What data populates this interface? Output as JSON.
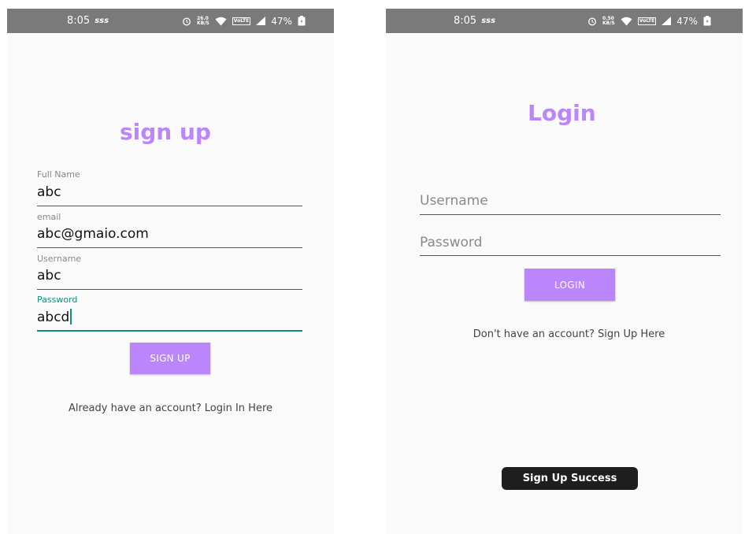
{
  "status_bar": {
    "time": "8:05",
    "carrier": "sss",
    "netspeed_left": "26.0",
    "netspeed_left_unit": "KB/S",
    "netspeed_right": "0.50",
    "netspeed_right_unit": "KB/S",
    "volte": "VoLTE",
    "battery": "47%"
  },
  "signup": {
    "title": "sign up",
    "fields": [
      {
        "label": "Full Name",
        "value": "abc"
      },
      {
        "label": "email",
        "value": "abc@gmaio.com"
      },
      {
        "label": "Username",
        "value": "abc"
      },
      {
        "label": "Password",
        "value": "abcd"
      }
    ],
    "button_label": "SIGN UP",
    "login_link": "Already have an account? Login In Here"
  },
  "login": {
    "title": "Login",
    "username_placeholder": "Username",
    "password_placeholder": "Password",
    "button_label": "LOGIN",
    "signup_link": "Don't have an account? Sign Up Here",
    "toast": "Sign Up Success"
  },
  "colors": {
    "accent": "#bb86fc",
    "focus": "#128c7e",
    "status_bar": "#7a7a7a",
    "toast_bg": "#1e1e1e"
  }
}
